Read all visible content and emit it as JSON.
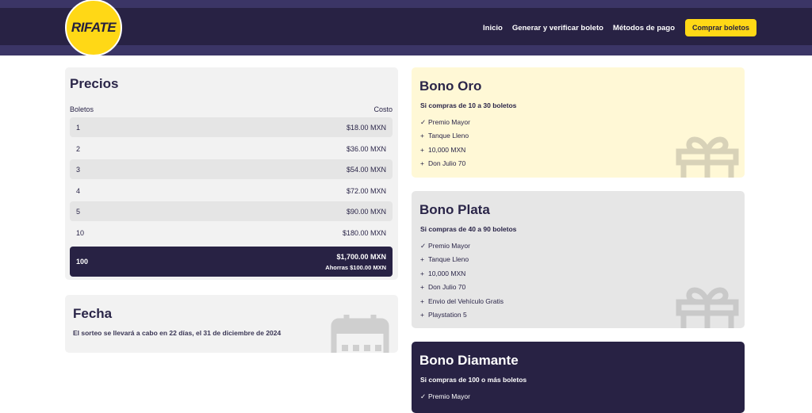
{
  "header": {
    "logo": "RIFATE",
    "nav": [
      "Inicio",
      "Generar y verificar boleto",
      "Métodos de pago"
    ],
    "cta": "Comprar boletos"
  },
  "colors": {
    "primary": "#282244",
    "accent": "#ffd816",
    "oro": "#fff8d6",
    "plata": "#e6e6e6"
  },
  "prices": {
    "title": "Precios",
    "col_tickets": "Boletos",
    "col_cost": "Costo",
    "rows": [
      {
        "qty": "1",
        "price": "$18.00 MXN"
      },
      {
        "qty": "2",
        "price": "$36.00 MXN"
      },
      {
        "qty": "3",
        "price": "$54.00 MXN"
      },
      {
        "qty": "4",
        "price": "$72.00 MXN"
      },
      {
        "qty": "5",
        "price": "$90.00 MXN"
      },
      {
        "qty": "10",
        "price": "$180.00 MXN"
      }
    ],
    "featured": {
      "qty": "100",
      "price": "$1,700.00 MXN",
      "saving": "Ahorras $100.00 MXN"
    }
  },
  "fecha": {
    "title": "Fecha",
    "text": "El sorteo se llevará a cabo en 22 días, el 31 de diciembre de 2024",
    "icon": "calendar-icon"
  },
  "bonos": {
    "oro": {
      "title": "Bono Oro",
      "subtitle": "Si compras de 10 a 30 boletos",
      "items": [
        {
          "mark": "✓",
          "text": "Premio Mayor"
        },
        {
          "mark": "+",
          "text": "Tanque Lleno"
        },
        {
          "mark": "+",
          "text": "10,000 MXN"
        },
        {
          "mark": "+",
          "text": "Don Julio 70"
        }
      ]
    },
    "plata": {
      "title": "Bono Plata",
      "subtitle": "Si compras de 40 a 90 boletos",
      "items": [
        {
          "mark": "✓",
          "text": "Premio Mayor"
        },
        {
          "mark": "+",
          "text": "Tanque Lleno"
        },
        {
          "mark": "+",
          "text": "10,000 MXN"
        },
        {
          "mark": "+",
          "text": "Don Julio 70"
        },
        {
          "mark": "+",
          "text": "Envio del Vehículo Gratis"
        },
        {
          "mark": "+",
          "text": "Playstation 5"
        }
      ]
    },
    "diamante": {
      "title": "Bono Diamante",
      "subtitle": "Si compras de 100 o más boletos",
      "items": [
        {
          "mark": "✓",
          "text": "Premio Mayor"
        }
      ]
    }
  }
}
